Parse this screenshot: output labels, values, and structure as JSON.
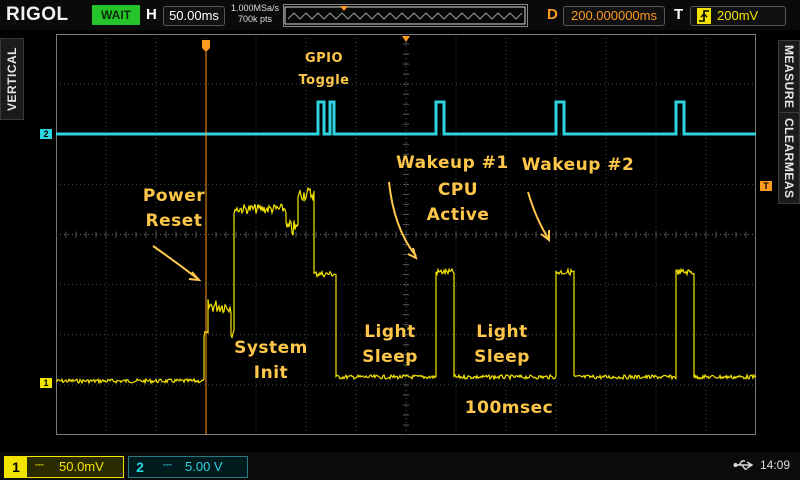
{
  "topbar": {
    "brand": "RIGOL",
    "run_state": "WAIT",
    "timebase_label": "H",
    "timebase_value": "50.00ms",
    "sample_rate": "1.000MSa/s",
    "memory_depth": "700k pts",
    "delay_label": "D",
    "delay_value": "200.000000ms",
    "trigger_label": "T",
    "trigger_icon": "rising-edge-icon",
    "trigger_level": "200mV"
  },
  "side_tabs": {
    "left": "VERTICAL",
    "right_top": "MEASURE",
    "right_bottom": "CLEARMEAS"
  },
  "markers": {
    "ch2_marker": "2",
    "ch1_marker": "1",
    "trigger_marker": "T"
  },
  "annotations": {
    "gpio_line1": "GPIO",
    "gpio_line2": "Toggle",
    "power_line1": "Power",
    "power_line2": "Reset",
    "sysinit_line1": "System",
    "sysinit_line2": "Init",
    "wake1": "Wakeup #1",
    "cpu_line1": "CPU",
    "cpu_line2": "Active",
    "wake2": "Wakeup #2",
    "light1_line1": "Light",
    "light1_line2": "Sleep",
    "light2_line1": "Light",
    "light2_line2": "Sleep",
    "interval": "100msec"
  },
  "bottombar": {
    "ch1_number": "1",
    "ch1_coupling": "⎓",
    "ch1_scale": "50.0mV",
    "ch2_number": "2",
    "ch2_coupling": "⎓",
    "ch2_scale": "5.00 V",
    "usb_icon": "usb-icon",
    "time": "14:09"
  },
  "colors": {
    "ch1": "#f3e400",
    "ch2": "#2fd2e0",
    "accent_orange": "#ff9a1e",
    "annotation": "#ffc74a",
    "grid": "#4a4a4a",
    "run_state_bg": "#25c42a"
  }
}
